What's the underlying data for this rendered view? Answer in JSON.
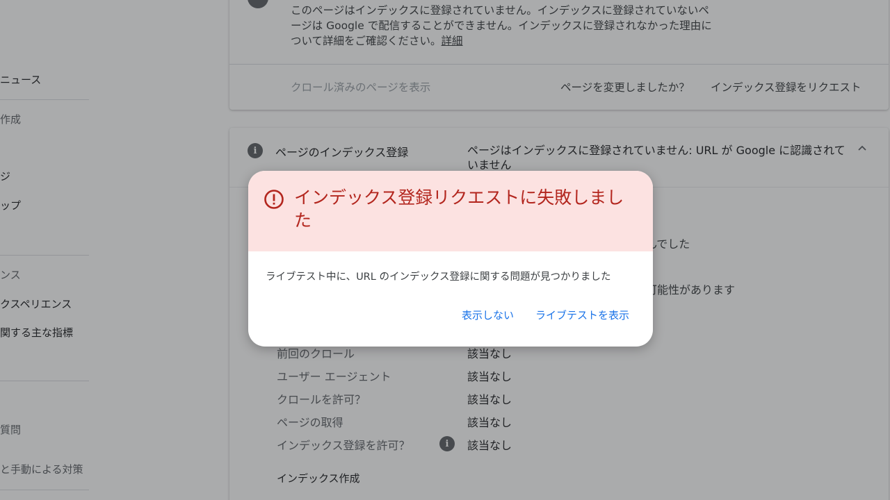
{
  "sidebar": {
    "items": [
      {
        "label": "ニュース"
      },
      {
        "label": "作成"
      },
      {
        "label": "ジ"
      },
      {
        "label": "ップ"
      },
      {
        "label": "ンス"
      },
      {
        "label": "クスペリエンス"
      },
      {
        "label": "関する主な指標"
      },
      {
        "label": "質問"
      },
      {
        "label": "と手動による対策"
      }
    ]
  },
  "top_card": {
    "description": "このページはインデックスに登録されていません。インデックスに登録されていないページは Google で配信することができません。インデックスに登録されなかった理由について詳細をご確認ください。",
    "details_link": "詳細",
    "view_crawled": "クロール済みのページを表示",
    "changed_question": "ページを変更しましたか？",
    "request_indexing": "インデックス登録をリクエスト"
  },
  "index_card": {
    "title": "ページのインデックス登録",
    "status": "ページはインデックスに登録されていません: URL が Google に認識されていません",
    "partial_1": "んでした",
    "partial_2": "可能性があります",
    "rows": [
      {
        "label": "前回のクロール",
        "value": "該当なし"
      },
      {
        "label": "ユーザー エージェント",
        "value": "該当なし"
      },
      {
        "label": "クロールを許可？",
        "value": "該当なし"
      },
      {
        "label": "ページの取得",
        "value": "該当なし"
      },
      {
        "label": "インデックス登録を許可？",
        "value": "該当なし"
      }
    ],
    "section_indexing": "インデックス作成"
  },
  "dialog": {
    "title": "インデックス登録リクエストに失敗しました",
    "body": "ライブテスト中に、URL のインデックス登録に関する問題が見つかりました",
    "dismiss_label": "表示しない",
    "view_live_test_label": "ライブテストを表示"
  },
  "colors": {
    "dialog_header_bg": "#fce2e1",
    "error_red": "#b3261e",
    "link_blue": "#1a73e8"
  }
}
